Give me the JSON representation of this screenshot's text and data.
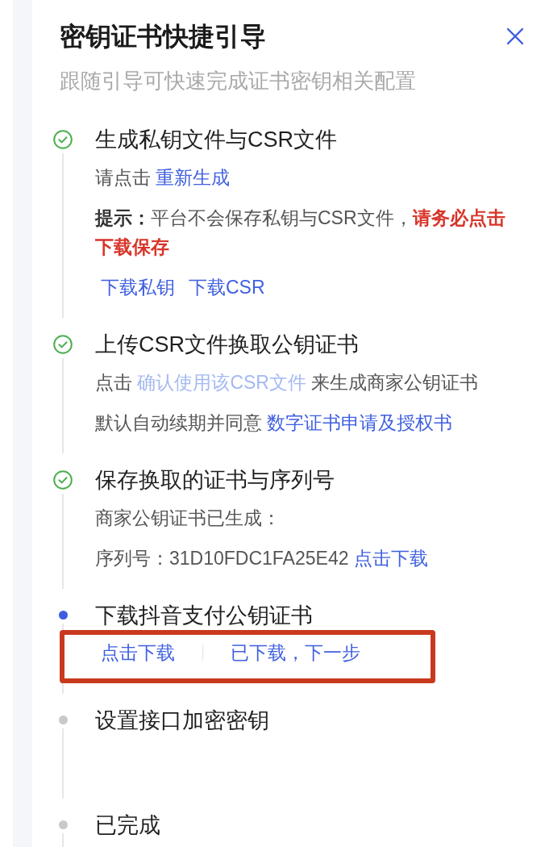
{
  "drawer": {
    "title": "密钥证书快捷引导",
    "subtitle": "跟随引导可快速完成证书密钥相关配置"
  },
  "steps": [
    {
      "kind": "done",
      "title": "生成私钥文件与CSR文件",
      "lines": [
        [
          {
            "kind": "text",
            "text": "请点击 "
          },
          {
            "kind": "link",
            "disabled": false,
            "text": "重新生成"
          }
        ],
        [
          {
            "kind": "label",
            "text": "提示："
          },
          {
            "kind": "text",
            "text": "平台不会保存私钥与CSR文件，"
          },
          {
            "kind": "alert",
            "text": "请务必点击下载保存"
          }
        ]
      ],
      "actions": {
        "divided": false,
        "highlighted": false,
        "items": [
          {
            "label": "下载私钥"
          },
          {
            "label": "下载CSR"
          }
        ]
      }
    },
    {
      "kind": "done",
      "title": "上传CSR文件换取公钥证书",
      "lines": [
        [
          {
            "kind": "text",
            "text": "点击 "
          },
          {
            "kind": "link",
            "disabled": true,
            "text": "确认使用该CSR文件"
          },
          {
            "kind": "text",
            "text": " 来生成商家公钥证书"
          }
        ],
        [
          {
            "kind": "text",
            "text": "默认自动续期并同意 "
          },
          {
            "kind": "link",
            "disabled": false,
            "text": "数字证书申请及授权书"
          }
        ]
      ]
    },
    {
      "kind": "done",
      "title": "保存换取的证书与序列号",
      "lines": [
        [
          {
            "kind": "text",
            "text": "商家公钥证书已生成："
          }
        ],
        [
          {
            "kind": "text",
            "text": "序列号：31D10FDC1FA25E42 "
          },
          {
            "kind": "link",
            "disabled": false,
            "text": "点击下载"
          }
        ]
      ]
    },
    {
      "kind": "current",
      "title": "下载抖音支付公钥证书",
      "actions": {
        "divided": true,
        "highlighted": true,
        "items": [
          {
            "label": "点击下载"
          },
          {
            "label": "已下载，下一步"
          }
        ]
      }
    },
    {
      "kind": "pending",
      "title": "设置接口加密密钥"
    },
    {
      "kind": "pending",
      "title": "已完成"
    }
  ]
}
